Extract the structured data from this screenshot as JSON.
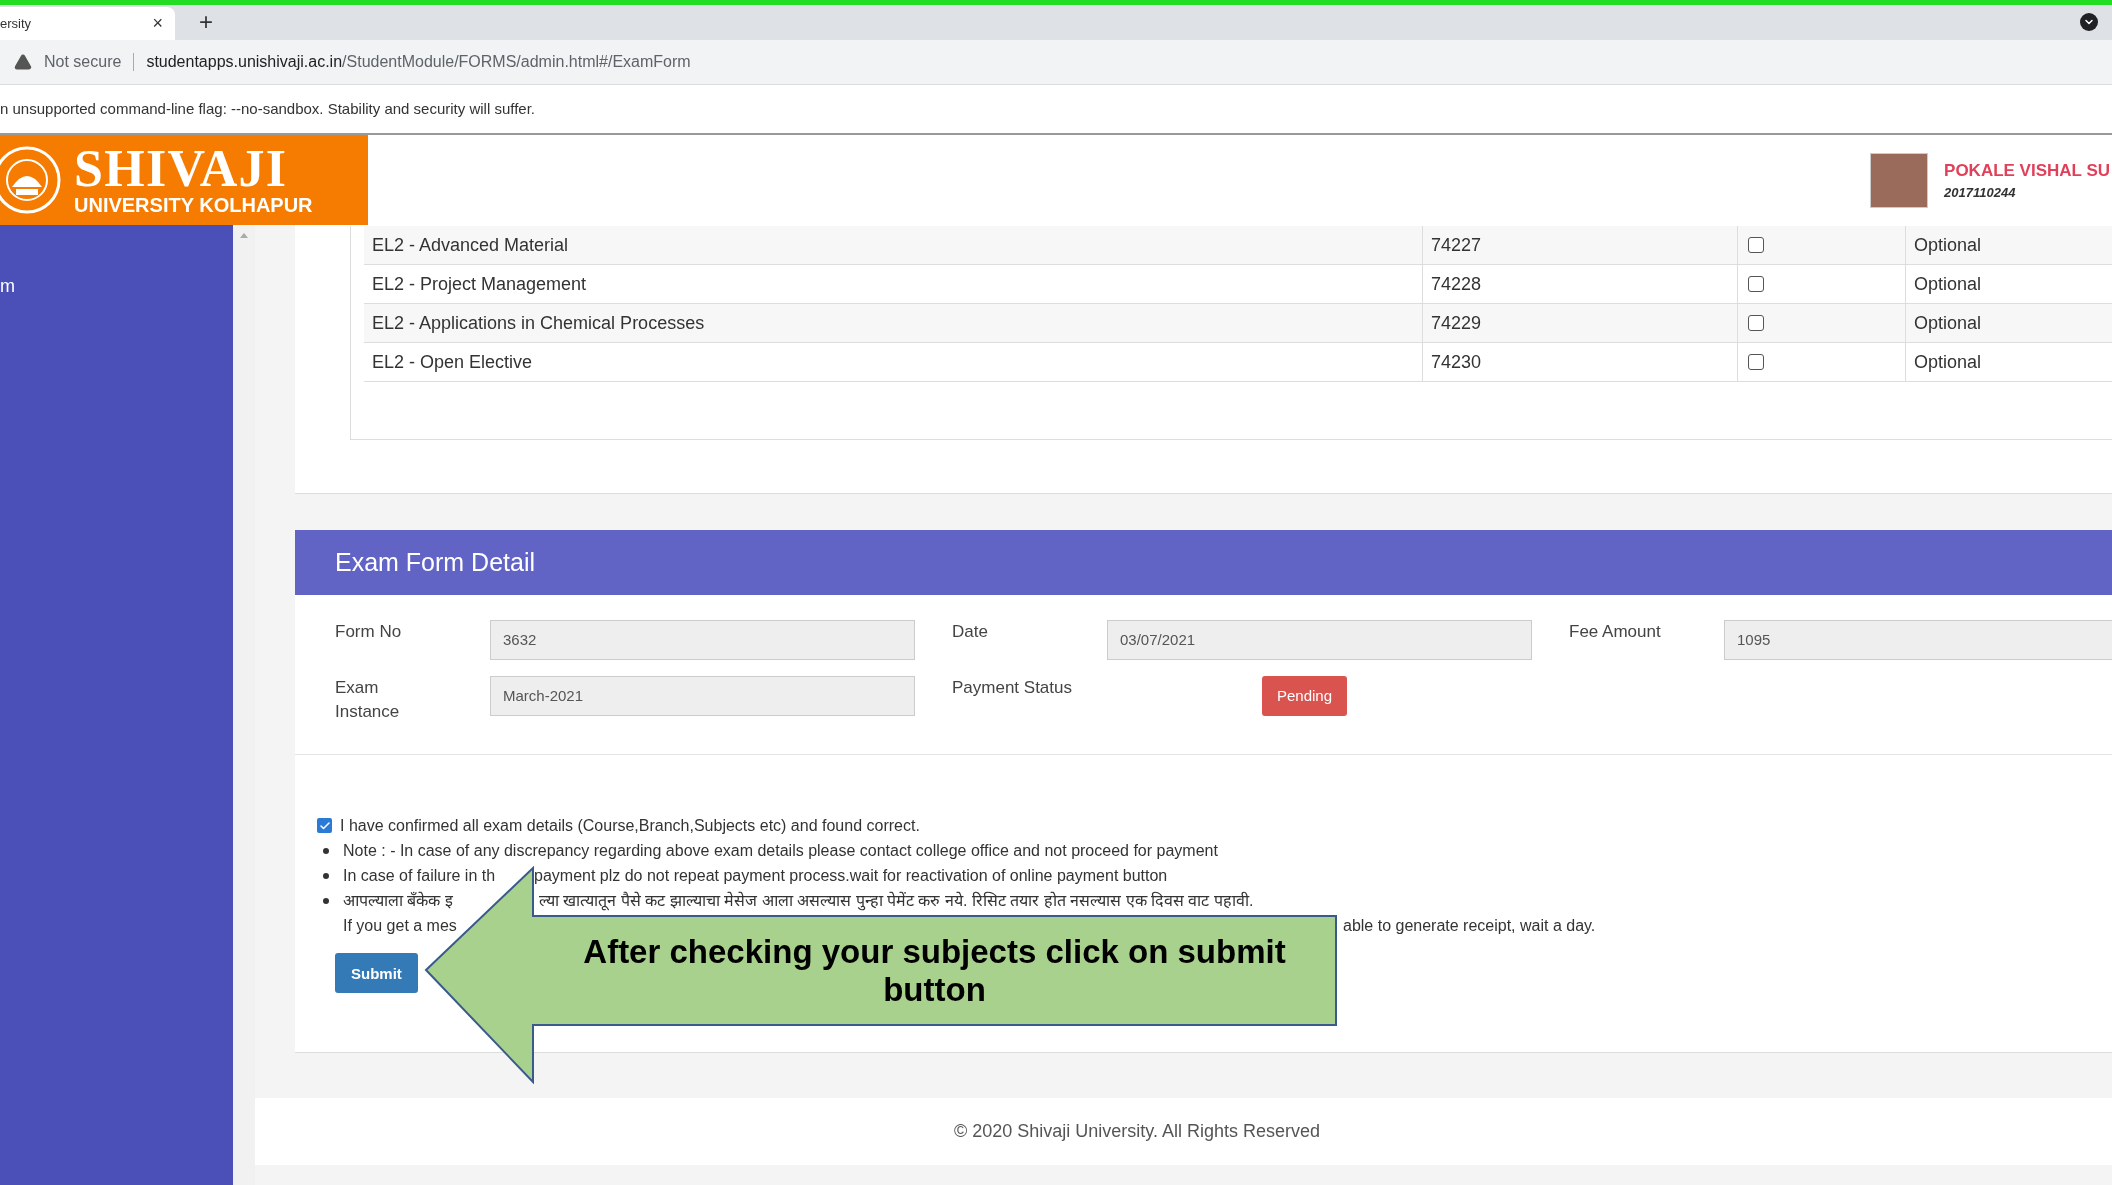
{
  "browser": {
    "tab_title": "ersity",
    "tab_close": "×",
    "new_tab": "+",
    "security": "Not secure",
    "url_host": "studentapps.unishivaji.ac.in",
    "url_path": "/StudentModule/FORMS/admin.html#/ExamForm",
    "infobar": "n unsupported command-line flag: --no-sandbox. Stability and security will suffer."
  },
  "header": {
    "logo_title": "SHIVAJI",
    "logo_subtitle": "UNIVERSITY KOLHAPUR",
    "user_name": "POKALE VISHAL SU",
    "user_id": "2017110244"
  },
  "sidebar": {
    "items": [
      {
        "label": "m"
      }
    ]
  },
  "subjects": [
    {
      "name": "EL2 - Advanced Material",
      "code": "74227",
      "checked": false,
      "type": "Optional"
    },
    {
      "name": "EL2 - Project Management",
      "code": "74228",
      "checked": false,
      "type": "Optional"
    },
    {
      "name": "EL2 - Applications in Chemical Processes",
      "code": "74229",
      "checked": false,
      "type": "Optional"
    },
    {
      "name": "EL2 - Open Elective",
      "code": "74230",
      "checked": false,
      "type": "Optional"
    }
  ],
  "exam_form": {
    "title": "Exam Form Detail",
    "fields": [
      {
        "label": "Form No",
        "value": "3632"
      },
      {
        "label": "Date",
        "value": "03/07/2021"
      },
      {
        "label": "Fee Amount",
        "value": "1095"
      },
      {
        "label": "Exam Instance",
        "value": "March-2021"
      }
    ],
    "payment_status": {
      "label": "Payment Status",
      "value": "Pending"
    },
    "confirm": {
      "checked": true,
      "label": "I have confirmed all exam details (Course,Branch,Subjects etc) and found correct."
    },
    "notes": [
      {
        "bullet": true,
        "parts": [
          "Note : - In case of any discrepancy regarding above exam details please contact college office and not proceed for payment"
        ]
      },
      {
        "bullet": true,
        "parts": [
          "In case of failure in th",
          "payment plz do not repeat payment process.wait for reactivation of online payment button"
        ]
      },
      {
        "bullet": true,
        "parts": [
          "आपल्याला बँकेक इ",
          "ल्या खात्यातून पैसे कट झाल्याचा मेसेज आला असल्यास पुन्हा पेमेंट करु नये. रिसिट तयार होत नसल्यास एक दिवस वाट पहावी."
        ]
      },
      {
        "bullet": false,
        "parts": [
          "If you get a mes",
          "able to generate receipt, wait a day."
        ]
      }
    ],
    "submit": "Submit"
  },
  "callout": "After checking your subjects click on submit button",
  "footer": "© 2020 Shivaji University. All Rights Reserved"
}
